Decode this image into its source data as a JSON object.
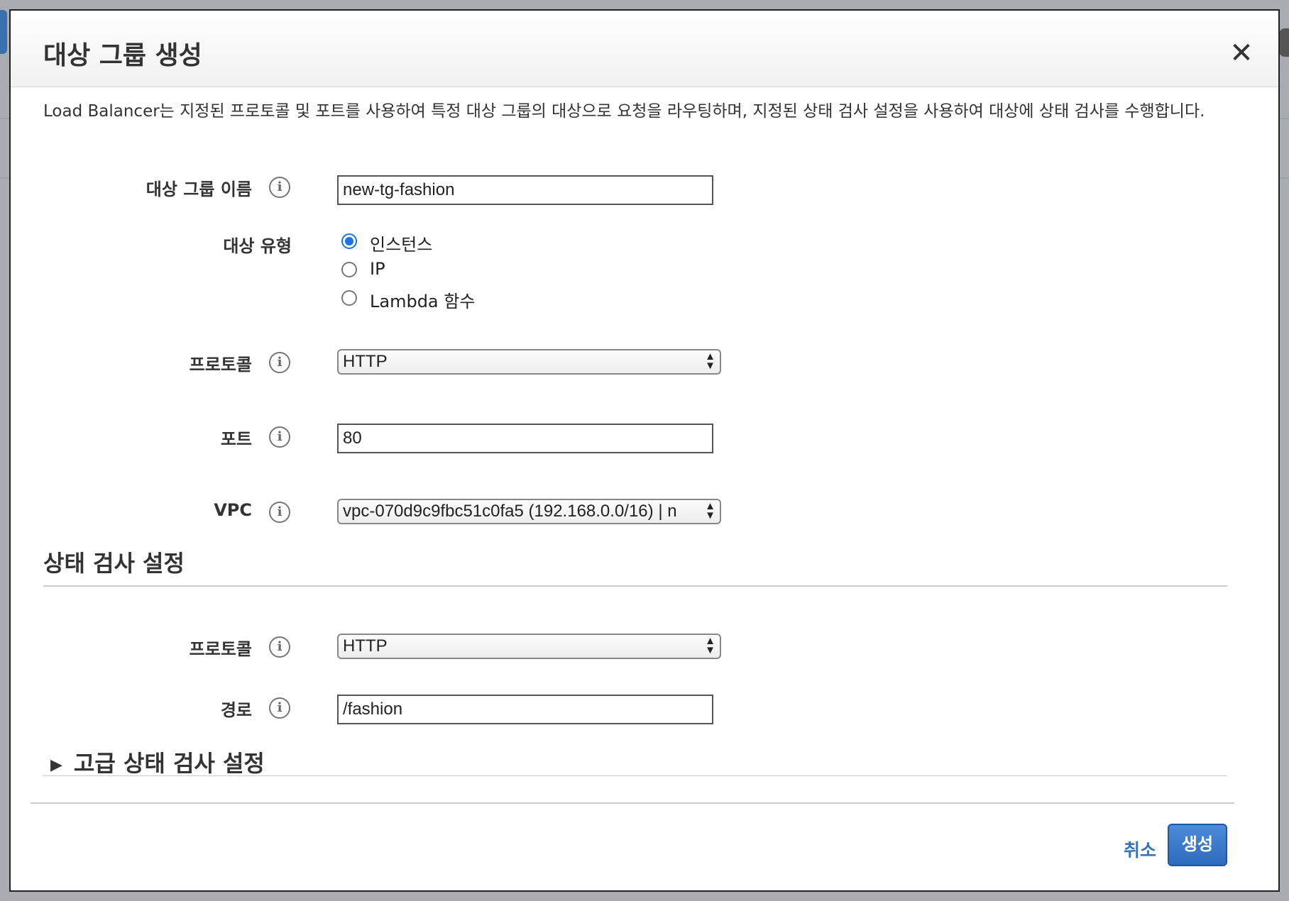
{
  "dialog": {
    "title": "대상 그룹 생성",
    "close": "✕",
    "description": "Load Balancer는 지정된 프로토콜 및 포트를 사용하여 특정 대상 그룹의 대상으로 요청을 라우팅하며, 지정된 상태 검사 설정을 사용하여 대상에 상태 검사를 수행합니다."
  },
  "form": {
    "target_group_name": {
      "label": "대상 그룹 이름",
      "value": "new-tg-fashion"
    },
    "target_type": {
      "label": "대상 유형",
      "options": [
        "인스턴스",
        "IP",
        "Lambda 함수"
      ],
      "selected": "인스턴스"
    },
    "protocol": {
      "label": "프로토콜",
      "value": "HTTP"
    },
    "port": {
      "label": "포트",
      "value": "80"
    },
    "vpc": {
      "label": "VPC",
      "value": "vpc-070d9c9fbc51c0fa5 (192.168.0.0/16) | n"
    }
  },
  "health_check": {
    "section_title": "상태 검사 설정",
    "protocol": {
      "label": "프로토콜",
      "value": "HTTP"
    },
    "path": {
      "label": "경로",
      "value": "/fashion"
    },
    "advanced_label": "고급 상태 검사 설정"
  },
  "footer": {
    "cancel": "취소",
    "create": "생성"
  },
  "icons": {
    "info": "i",
    "caret": "▶",
    "select_arrows": "▲▼"
  },
  "colors": {
    "accent": "#1a73e8",
    "primary_button": "#2d6bbd",
    "link": "#3a74b8"
  }
}
